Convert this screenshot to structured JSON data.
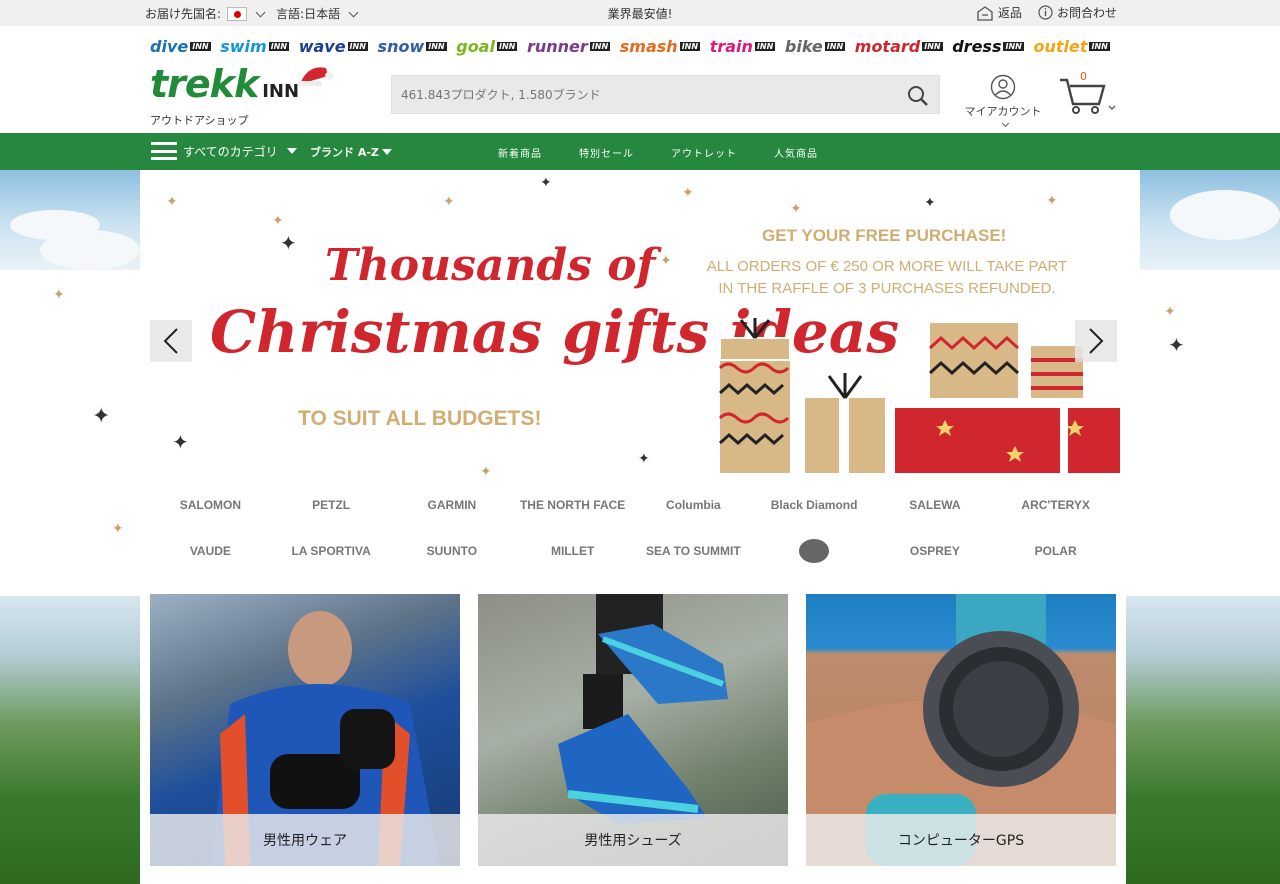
{
  "topbar": {
    "ship_to_label": "お届け先国名:",
    "language_label": "言語:日本語",
    "promo": "業界最安値!",
    "returns": "返品",
    "contact": "お問合わせ"
  },
  "brand_sites": [
    {
      "name": "dive",
      "color": "#1a6fb5"
    },
    {
      "name": "swim",
      "color": "#1597d6"
    },
    {
      "name": "wave",
      "color": "#1d3f8f"
    },
    {
      "name": "snow",
      "color": "#2e5ea8"
    },
    {
      "name": "goal",
      "color": "#7ab81e"
    },
    {
      "name": "runner",
      "color": "#7b3a8e"
    },
    {
      "name": "smash",
      "color": "#e76a1d"
    },
    {
      "name": "train",
      "color": "#e0197d"
    },
    {
      "name": "bike",
      "color": "#666666"
    },
    {
      "name": "motard",
      "color": "#d0262e"
    },
    {
      "name": "dress",
      "color": "#111111"
    },
    {
      "name": "outlet",
      "color": "#f2a516"
    }
  ],
  "inn_tag": "INN",
  "logo": {
    "word": "trekk",
    "suffix": "INN",
    "tagline": "アウトドアショップ"
  },
  "search": {
    "placeholder": "461.843プロダクト, 1.580ブランド"
  },
  "account": {
    "label": "マイアカウント"
  },
  "cart": {
    "count": "0"
  },
  "nav": {
    "categories": "すべてのカテゴリ",
    "brands": "ブランド A-Z",
    "links": [
      "新着商品",
      "特別セール",
      "アウトレット",
      "人気商品"
    ]
  },
  "hero": {
    "line1": "Thousands of",
    "line2": "Christmas gifts ideas",
    "budgets": "TO SUIT ALL BUDGETS!",
    "free": "GET YOUR FREE PURCHASE!",
    "orders1": "ALL ORDERS OF € 250 OR MORE WILL TAKE PART",
    "orders2": "IN THE RAFFLE OF 3 PURCHASES REFUNDED."
  },
  "brand_logos": [
    "SALOMON",
    "PETZL",
    "GARMIN",
    "THE NORTH FACE",
    "Columbia",
    "Black Diamond",
    "SALEWA",
    "ARC'TERYX",
    "VAUDE",
    "LA SPORTIVA",
    "SUUNTO",
    "MILLET",
    "SEA TO SUMMIT",
    "",
    "OSPREY",
    "POLAR"
  ],
  "tiles": [
    {
      "label": "男性用ウェア"
    },
    {
      "label": "男性用シューズ"
    },
    {
      "label": "コンピューターGPS"
    }
  ],
  "colors": {
    "accent": "#26883e",
    "hero_red": "#d0262e",
    "hero_gold": "#d1ad72",
    "cart_count": "#e35b0f"
  }
}
